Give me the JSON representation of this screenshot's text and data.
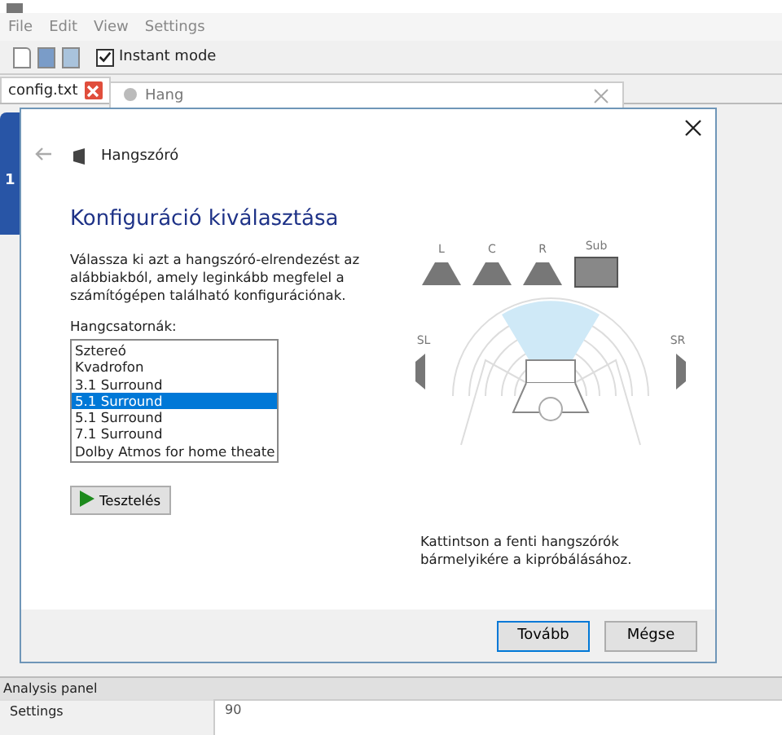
{
  "menu": [
    "File",
    "Edit",
    "View",
    "Settings"
  ],
  "toolbar": {
    "instant_mode": {
      "label": "Instant mode",
      "checked": true
    }
  },
  "tabs": [
    {
      "label": "config.txt",
      "selected": true
    }
  ],
  "side_marker": "1",
  "back_dialog": {
    "title": "Hang"
  },
  "dialog": {
    "breadcrumb": "Hangszóró",
    "heading": "Konfiguráció kiválasztása",
    "description": "Válassza ki azt a hangszóró-elrendezést az alábbiakból, amely leginkább megfelel a számítógépen található konfigurációnak.",
    "channels_label": "Hangcsatornák:",
    "channels": [
      {
        "label": "Sztereó",
        "selected": false
      },
      {
        "label": "Kvadrofon",
        "selected": false
      },
      {
        "label": "3.1 Surround",
        "selected": false
      },
      {
        "label": "5.1 Surround",
        "selected": true
      },
      {
        "label": "5.1 Surround",
        "selected": false
      },
      {
        "label": "7.1 Surround",
        "selected": false
      },
      {
        "label": "Dolby Atmos for home theate",
        "selected": false
      }
    ],
    "test_button": "Tesztelés",
    "speakers": [
      {
        "label": "L",
        "kind": "front"
      },
      {
        "label": "C",
        "kind": "front"
      },
      {
        "label": "R",
        "kind": "front"
      },
      {
        "label": "Sub",
        "kind": "sub"
      },
      {
        "label": "SL",
        "kind": "side-left"
      },
      {
        "label": "SR",
        "kind": "side-right"
      }
    ],
    "hint": "Kattintson a fenti hangszórók bármelyikére a kipróbálásához.",
    "buttons": [
      {
        "label": "Tovább",
        "kind": "default"
      },
      {
        "label": "Mégse",
        "kind": "normal"
      }
    ]
  },
  "analysis_panel": {
    "title": "Analysis panel",
    "settings": "Settings",
    "value": "90"
  }
}
